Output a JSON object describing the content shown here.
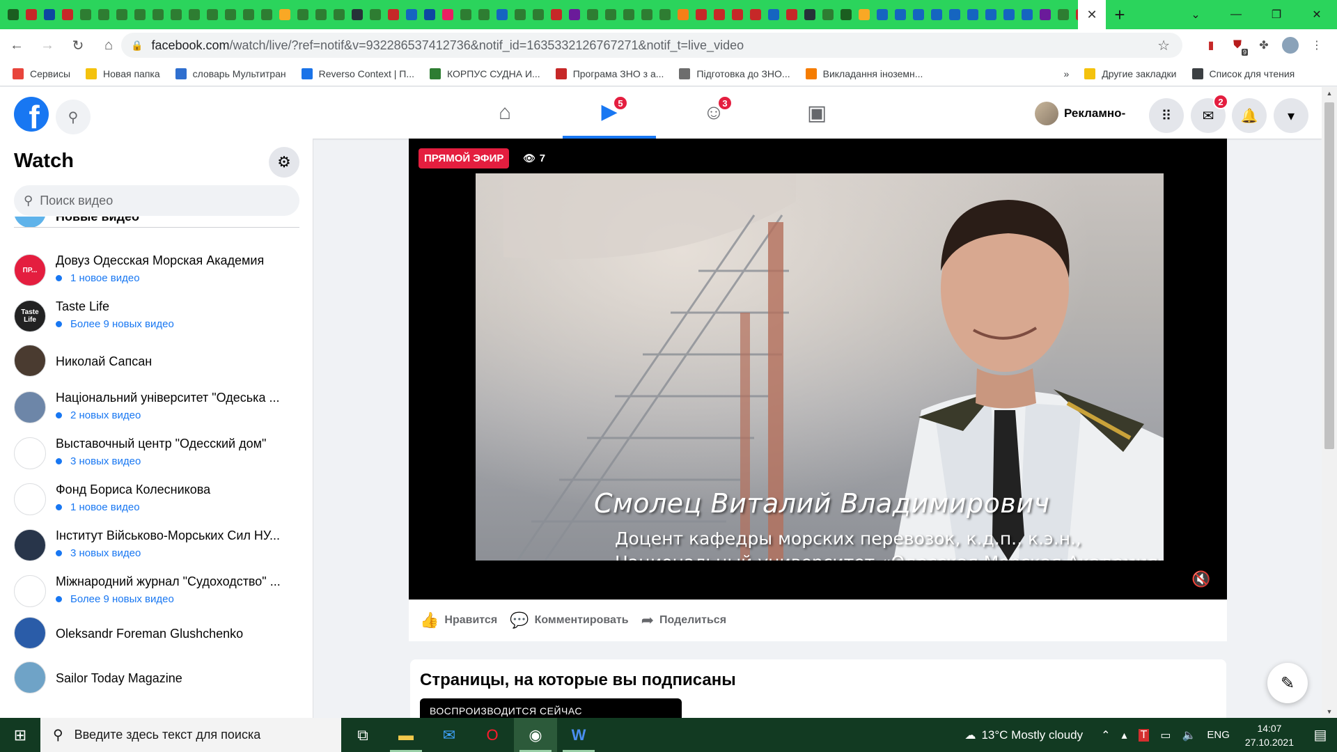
{
  "browser": {
    "url_host": "facebook.com",
    "url_path": "/watch/live/?ref=notif&v=932286537412736&notif_id=1635332126767271&notif_t=live_video",
    "new_tab": "+",
    "close_tab": "✕",
    "ext_badge": "9"
  },
  "bookmarks": [
    {
      "label": "Сервисы",
      "icon": "apps-grid-icon",
      "color": "#e8453c"
    },
    {
      "label": "Новая папка",
      "icon": "folder-icon",
      "color": "#f4c20d"
    },
    {
      "label": "словарь Мультитран",
      "icon": "globe-icon",
      "color": "#2f6fcf"
    },
    {
      "label": "Reverso Context | П...",
      "icon": "reverso-icon",
      "color": "#1a73e8"
    },
    {
      "label": "КОРПУС СУДНА И...",
      "icon": "tree-icon",
      "color": "#2e7d32"
    },
    {
      "label": "Програма ЗНО з а...",
      "icon": "flag-icon",
      "color": "#c62828"
    },
    {
      "label": "Підготовка до ЗНО...",
      "icon": "book-icon",
      "color": "#6d6d6d"
    },
    {
      "label": "Викладання іноземн...",
      "icon": "blogger-icon",
      "color": "#f57c00"
    },
    {
      "label": "»",
      "icon": "chevron-icon",
      "color": "#3c4043"
    },
    {
      "label": "Другие закладки",
      "icon": "folder-icon",
      "color": "#f4c20d"
    },
    {
      "label": "Список для чтения",
      "icon": "reading-list-icon",
      "color": "#3c4043"
    }
  ],
  "fb_header": {
    "logo": "f",
    "watch_badge": "5",
    "groups_badge": "3",
    "profile_name": "Рекламно-",
    "messenger_badge": "2"
  },
  "sidebar": {
    "title": "Watch",
    "search_placeholder": "Поиск видео",
    "partial_item": "Новые видео",
    "items": [
      {
        "name": "Довуз Одесская Морская Академия",
        "sub": "1 новое видео",
        "avatar_text": "ПР...",
        "avatar_color": "#e41e3f"
      },
      {
        "name": "Taste Life",
        "sub": "Более 9 новых видео",
        "avatar_text": "Taste Life",
        "avatar_color": "#222222"
      },
      {
        "name": "Николай Сапсан",
        "sub": "",
        "avatar_text": "",
        "avatar_color": "#4a3b30"
      },
      {
        "name": "Національний університет \"Одеська ...",
        "sub": "2 новых видео",
        "avatar_text": "",
        "avatar_color": "#6d86a8"
      },
      {
        "name": "Выставочный центр \"Одесский дом\"",
        "sub": "3 новых видео",
        "avatar_text": "",
        "avatar_color": "#ffffff"
      },
      {
        "name": "Фонд Бориса Колесникова",
        "sub": "1 новое видео",
        "avatar_text": "",
        "avatar_color": "#ffffff"
      },
      {
        "name": "Інститут Військово-Морських Сил НУ...",
        "sub": "3 новых видео",
        "avatar_text": "",
        "avatar_color": "#28354a"
      },
      {
        "name": "Міжнародний журнал \"Судоходство\" ...",
        "sub": "Более 9 новых видео",
        "avatar_text": "",
        "avatar_color": "#ffffff"
      },
      {
        "name": "Oleksandr Foreman Glushchenko",
        "sub": "",
        "avatar_text": "",
        "avatar_color": "#2a5ca8"
      },
      {
        "name": "Sailor Today Magazine",
        "sub": "",
        "avatar_text": "",
        "avatar_color": "#6fa3c7"
      }
    ]
  },
  "video": {
    "live_label": "ПРЯМОЙ ЭФИР",
    "viewers": "7",
    "caption_name": "Смолец Виталий Владимирович",
    "caption_line1": "Доцент кафедры морских перевозок, к.д.п., к.э.н.,",
    "caption_line2": "Национальный университет «Одесская Морская Академия»"
  },
  "actions": {
    "like": "Нравится",
    "comment": "Комментировать",
    "share": "Поделиться"
  },
  "pages_section": {
    "title": "Страницы, на которые вы подписаны",
    "now_playing": "ВОСПРОИЗВОДИТСЯ СЕЙЧАС"
  },
  "taskbar": {
    "search_placeholder": "Введите здесь текст для поиска",
    "weather": "13°C  Mostly cloudy",
    "lang": "ENG",
    "time": "14:07",
    "date": "27.10.2021"
  }
}
